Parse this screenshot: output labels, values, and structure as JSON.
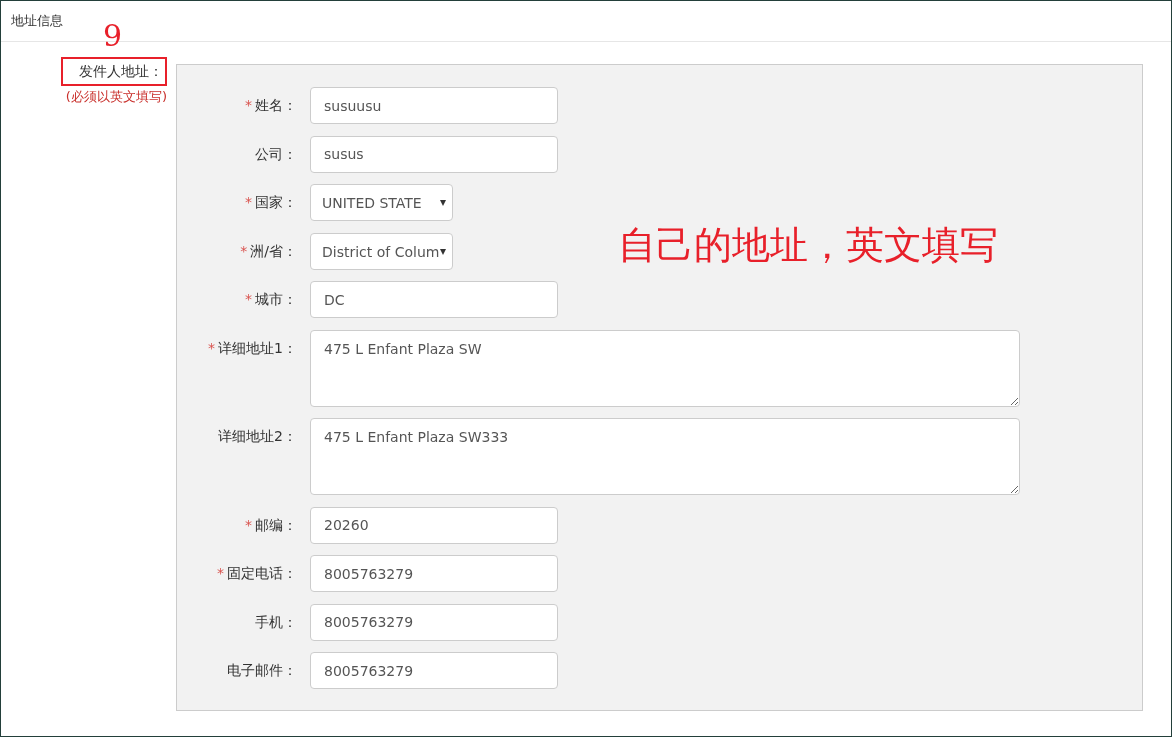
{
  "header": {
    "title": "地址信息"
  },
  "sender": {
    "label": "发件人地址：",
    "boxed": true,
    "note": "(必须以英文填写)"
  },
  "fields": [
    {
      "kind": "input",
      "required_mark": "*",
      "label": "姓名：",
      "value": "susuusu"
    },
    {
      "kind": "input",
      "label": "公司：",
      "value": "susus"
    },
    {
      "kind": "select",
      "required_mark": "*",
      "label": "国家：",
      "value": "UNITED STATE"
    },
    {
      "kind": "select",
      "required_mark": "*",
      "label": "洲/省：",
      "value": "District of Colum"
    },
    {
      "kind": "input",
      "required_mark": "*",
      "label": "城市：",
      "value": "DC"
    },
    {
      "kind": "textarea",
      "required_mark": "*",
      "label": "详细地址1：",
      "value": "475 L Enfant Plaza SW"
    },
    {
      "kind": "textarea",
      "label": "详细地址2：",
      "value": "475 L Enfant Plaza SW333"
    },
    {
      "kind": "input",
      "required_mark": "*",
      "label": "邮编：",
      "value": "20260"
    },
    {
      "kind": "input",
      "required_mark": "*",
      "label": "固定电话：",
      "value": "8005763279"
    },
    {
      "kind": "input",
      "label": "手机：",
      "value": "8005763279"
    },
    {
      "kind": "input",
      "label": "电子邮件：",
      "value": "8005763279"
    }
  ],
  "annotations": [
    {
      "kind": "number",
      "text": "9"
    },
    {
      "kind": "note",
      "text": "自己的地址，英文填写"
    }
  ]
}
